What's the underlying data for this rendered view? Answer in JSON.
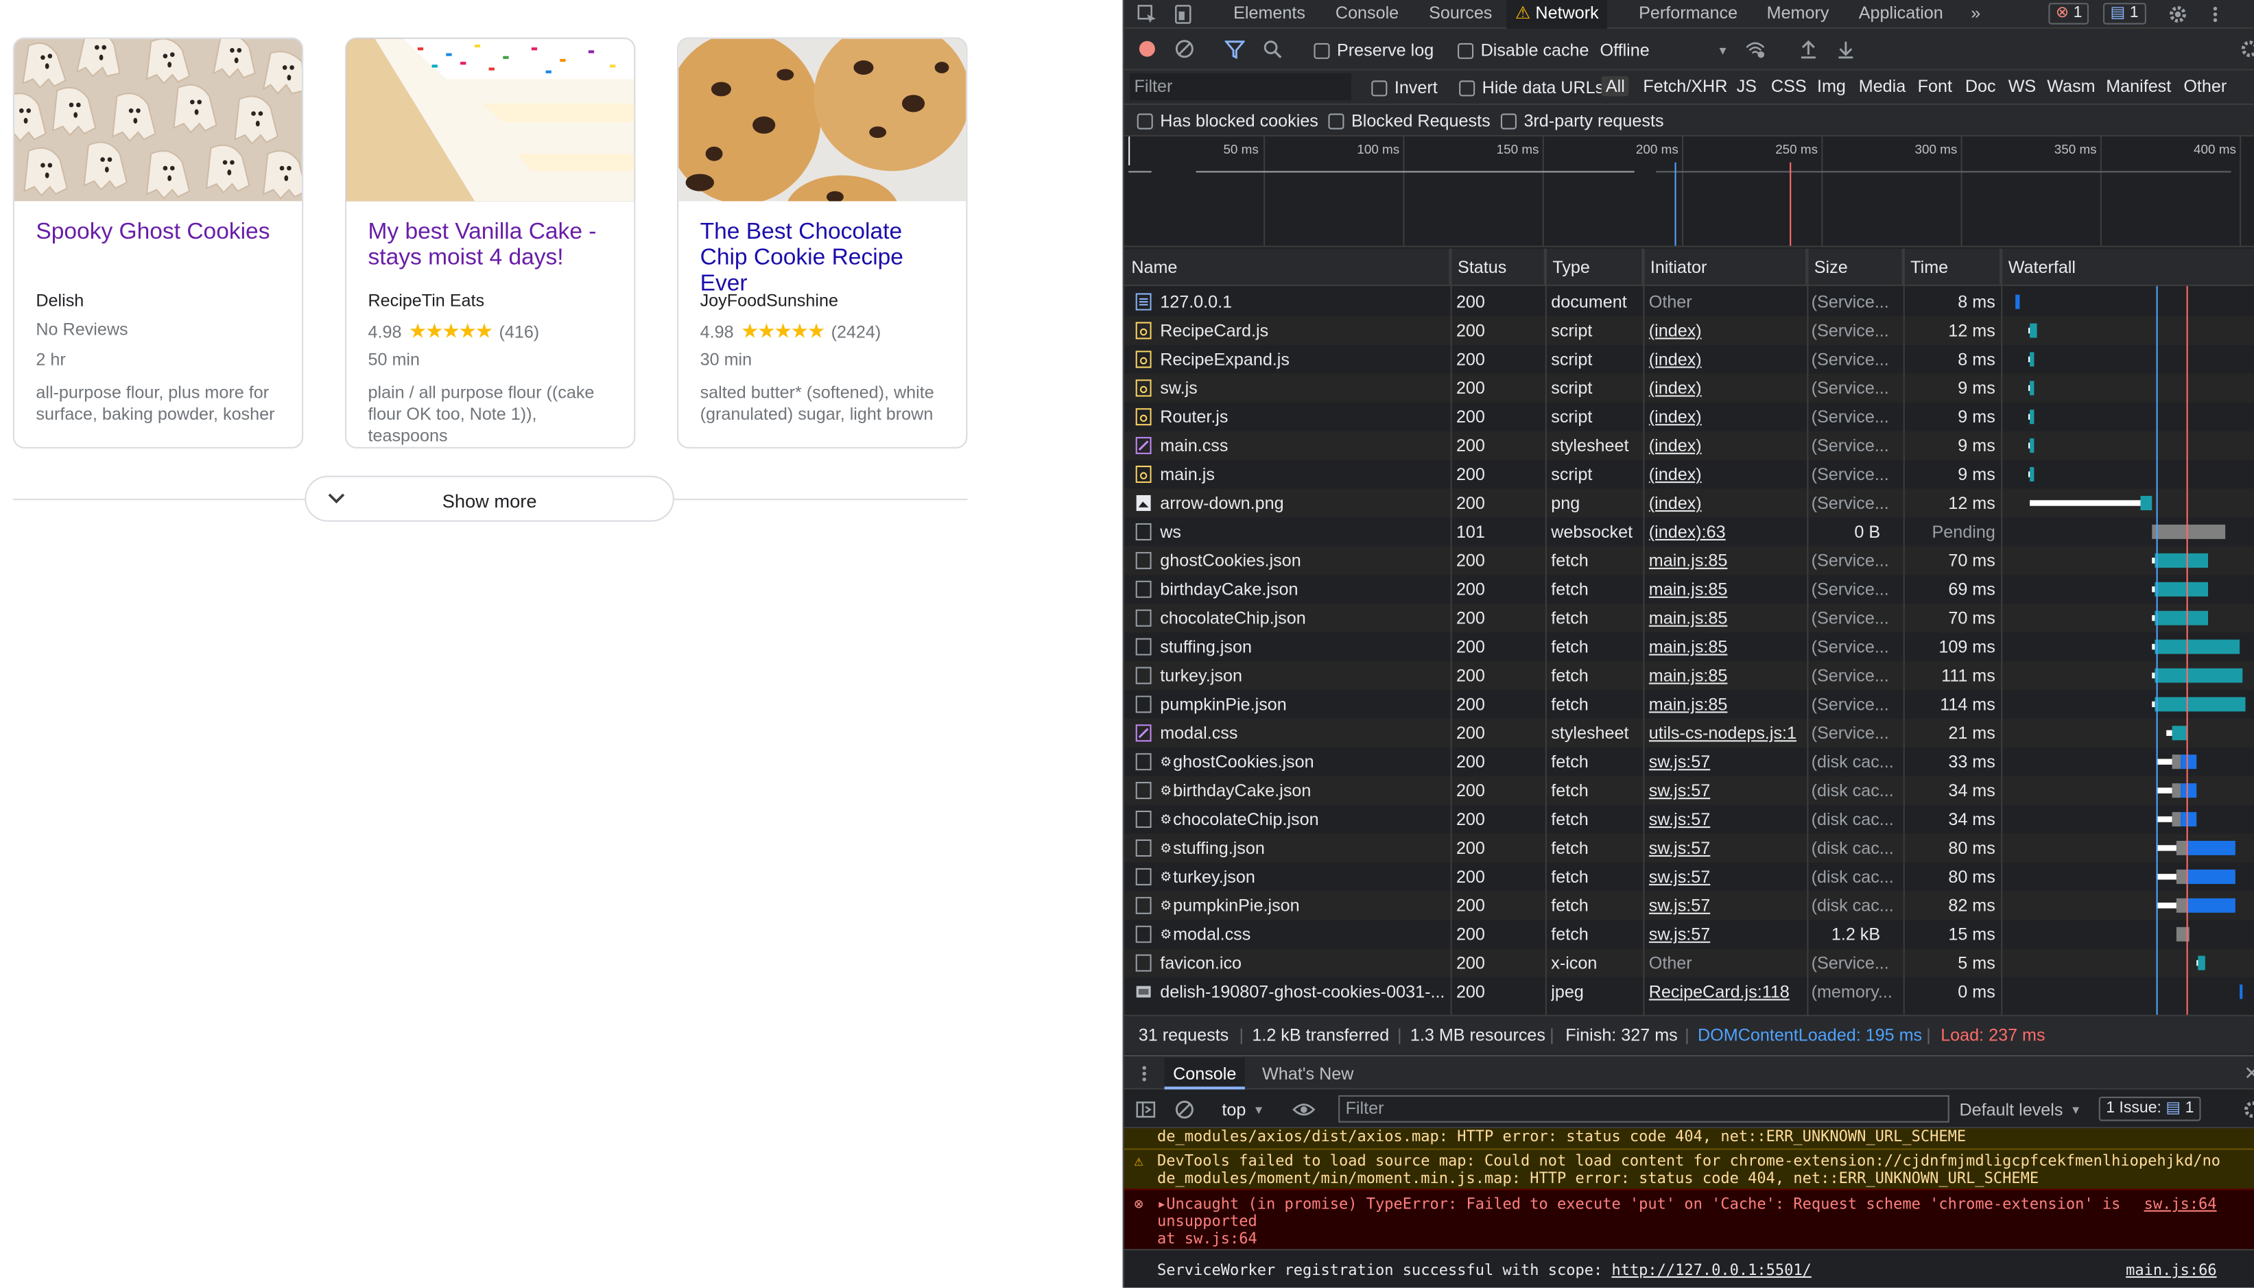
{
  "cards": [
    {
      "title": "Spooky Ghost Cookies",
      "source": "Delish",
      "rating": "",
      "stars": "",
      "reviews": "",
      "no_reviews": "No Reviews",
      "time": "2 hr",
      "ingredients": "all-purpose flour, plus more for surface, baking powder, kosher"
    },
    {
      "title": "My best Vanilla Cake - stays moist 4 days!",
      "source": "RecipeTin Eats",
      "rating": "4.98",
      "stars": "★★★★★",
      "reviews": "(416)",
      "no_reviews": "",
      "time": "50 min",
      "ingredients": "plain / all purpose flour ((cake flour OK too, Note 1)), teaspoons"
    },
    {
      "title": "The Best Chocolate Chip Cookie Recipe Ever",
      "source": "JoyFoodSunshine",
      "rating": "4.98",
      "stars": "★★★★★",
      "reviews": "(2424)",
      "no_reviews": "",
      "time": "30 min",
      "ingredients": "salted butter* (softened), white (granulated) sugar, light brown"
    }
  ],
  "show_more": "Show more",
  "devtools": {
    "tabs": [
      "Elements",
      "Console",
      "Sources",
      "Network",
      "Performance",
      "Memory",
      "Application"
    ],
    "active_tab": "Network",
    "more_tabs": "»",
    "error_count": "1",
    "issue_count": "1",
    "toolbar": {
      "preserve_log": "Preserve log",
      "disable_cache": "Disable cache",
      "throttle": "Offline"
    },
    "filter": {
      "placeholder": "Filter",
      "invert": "Invert",
      "hide_data_urls": "Hide data URLs",
      "types": [
        "All",
        "Fetch/XHR",
        "JS",
        "CSS",
        "Img",
        "Media",
        "Font",
        "Doc",
        "WS",
        "Wasm",
        "Manifest",
        "Other"
      ]
    },
    "blocked": {
      "has_blocked_cookies": "Has blocked cookies",
      "blocked_requests": "Blocked Requests",
      "third_party": "3rd-party requests"
    },
    "overview_ticks": [
      "50 ms",
      "100 ms",
      "150 ms",
      "200 ms",
      "250 ms",
      "300 ms",
      "350 ms",
      "400 ms"
    ],
    "columns": [
      "Name",
      "Status",
      "Type",
      "Initiator",
      "Size",
      "Time",
      "Waterfall"
    ],
    "rows": [
      {
        "icon": "doc",
        "name": "127.0.0.1",
        "status": "200",
        "type": "document",
        "initiator": "Other",
        "size": "(Service...",
        "time": "8 ms",
        "wf": [
          {
            "s": 0.04,
            "w": 0.02,
            "c": "#1a73e8"
          }
        ]
      },
      {
        "icon": "js",
        "name": "RecipeCard.js",
        "status": "200",
        "type": "script",
        "initiator": "(index)",
        "size": "(Service...",
        "time": "12 ms",
        "wf": [
          {
            "s": 0.095,
            "w": 0.005,
            "c": "#ffffff"
          },
          {
            "s": 0.1,
            "w": 0.03,
            "c": "#1a9ca8"
          }
        ]
      },
      {
        "icon": "js",
        "name": "RecipeExpand.js",
        "status": "200",
        "type": "script",
        "initiator": "(index)",
        "size": "(Service...",
        "time": "8 ms",
        "wf": [
          {
            "s": 0.095,
            "w": 0.005,
            "c": "#ffffff"
          },
          {
            "s": 0.1,
            "w": 0.02,
            "c": "#1a9ca8"
          }
        ]
      },
      {
        "icon": "js",
        "name": "sw.js",
        "status": "200",
        "type": "script",
        "initiator": "(index)",
        "size": "(Service...",
        "time": "9 ms",
        "wf": [
          {
            "s": 0.095,
            "w": 0.005,
            "c": "#ffffff"
          },
          {
            "s": 0.1,
            "w": 0.02,
            "c": "#1a9ca8"
          }
        ]
      },
      {
        "icon": "js",
        "name": "Router.js",
        "status": "200",
        "type": "script",
        "initiator": "(index)",
        "size": "(Service...",
        "time": "9 ms",
        "wf": [
          {
            "s": 0.095,
            "w": 0.005,
            "c": "#ffffff"
          },
          {
            "s": 0.1,
            "w": 0.02,
            "c": "#1a9ca8"
          }
        ]
      },
      {
        "icon": "css",
        "name": "main.css",
        "status": "200",
        "type": "stylesheet",
        "initiator": "(index)",
        "size": "(Service...",
        "time": "9 ms",
        "wf": [
          {
            "s": 0.095,
            "w": 0.005,
            "c": "#ffffff"
          },
          {
            "s": 0.1,
            "w": 0.02,
            "c": "#1a9ca8"
          }
        ]
      },
      {
        "icon": "js",
        "name": "main.js",
        "status": "200",
        "type": "script",
        "initiator": "(index)",
        "size": "(Service...",
        "time": "9 ms",
        "wf": [
          {
            "s": 0.095,
            "w": 0.005,
            "c": "#ffffff"
          },
          {
            "s": 0.1,
            "w": 0.02,
            "c": "#1a9ca8"
          }
        ]
      },
      {
        "icon": "img",
        "name": "arrow-down.png",
        "status": "200",
        "type": "png",
        "initiator": "(index)",
        "size": "(Service...",
        "time": "12 ms",
        "wf": [
          {
            "s": 0.1,
            "w": 0.45,
            "c": "#ffffff"
          },
          {
            "s": 0.55,
            "w": 0.05,
            "c": "#1a9ca8"
          }
        ]
      },
      {
        "icon": "other",
        "name": "ws",
        "status": "101",
        "type": "websocket",
        "initiator": "(index):63",
        "size": "0 B",
        "size_num": true,
        "time": "Pending",
        "pending": true,
        "wf": [
          {
            "s": 0.6,
            "w": 0.3,
            "c": "#808080"
          }
        ]
      },
      {
        "icon": "other",
        "name": "ghostCookies.json",
        "status": "200",
        "type": "fetch",
        "initiator": "main.js:85",
        "size": "(Service...",
        "time": "70 ms",
        "wf": [
          {
            "s": 0.6,
            "w": 0.01,
            "c": "#ffffff"
          },
          {
            "s": 0.61,
            "w": 0.22,
            "c": "#1a9ca8"
          }
        ]
      },
      {
        "icon": "other",
        "name": "birthdayCake.json",
        "status": "200",
        "type": "fetch",
        "initiator": "main.js:85",
        "size": "(Service...",
        "time": "69 ms",
        "wf": [
          {
            "s": 0.6,
            "w": 0.01,
            "c": "#ffffff"
          },
          {
            "s": 0.61,
            "w": 0.22,
            "c": "#1a9ca8"
          }
        ]
      },
      {
        "icon": "other",
        "name": "chocolateChip.json",
        "status": "200",
        "type": "fetch",
        "initiator": "main.js:85",
        "size": "(Service...",
        "time": "70 ms",
        "wf": [
          {
            "s": 0.6,
            "w": 0.01,
            "c": "#ffffff"
          },
          {
            "s": 0.61,
            "w": 0.22,
            "c": "#1a9ca8"
          }
        ]
      },
      {
        "icon": "other",
        "name": "stuffing.json",
        "status": "200",
        "type": "fetch",
        "initiator": "main.js:85",
        "size": "(Service...",
        "time": "109 ms",
        "wf": [
          {
            "s": 0.6,
            "w": 0.01,
            "c": "#ffffff"
          },
          {
            "s": 0.61,
            "w": 0.35,
            "c": "#1a9ca8"
          }
        ]
      },
      {
        "icon": "other",
        "name": "turkey.json",
        "status": "200",
        "type": "fetch",
        "initiator": "main.js:85",
        "size": "(Service...",
        "time": "111 ms",
        "wf": [
          {
            "s": 0.6,
            "w": 0.01,
            "c": "#ffffff"
          },
          {
            "s": 0.61,
            "w": 0.36,
            "c": "#1a9ca8"
          }
        ]
      },
      {
        "icon": "other",
        "name": "pumpkinPie.json",
        "status": "200",
        "type": "fetch",
        "initiator": "main.js:85",
        "size": "(Service...",
        "time": "114 ms",
        "wf": [
          {
            "s": 0.6,
            "w": 0.01,
            "c": "#ffffff"
          },
          {
            "s": 0.61,
            "w": 0.37,
            "c": "#1a9ca8"
          }
        ]
      },
      {
        "icon": "css",
        "name": "modal.css",
        "status": "200",
        "type": "stylesheet",
        "initiator": "utils-cs-nodeps.js:1",
        "size": "(Service...",
        "time": "21 ms",
        "wf": [
          {
            "s": 0.66,
            "w": 0.02,
            "c": "#ffffff"
          },
          {
            "s": 0.68,
            "w": 0.06,
            "c": "#1a9ca8"
          }
        ]
      },
      {
        "icon": "other",
        "gear": true,
        "name": "ghostCookies.json",
        "status": "200",
        "type": "fetch",
        "initiator": "sw.js:57",
        "size": "(disk cac...",
        "time": "33 ms",
        "wf": [
          {
            "s": 0.62,
            "w": 0.06,
            "c": "#ffffff"
          },
          {
            "s": 0.68,
            "w": 0.04,
            "c": "#808080"
          },
          {
            "s": 0.72,
            "w": 0.06,
            "c": "#1a73e8"
          }
        ]
      },
      {
        "icon": "other",
        "gear": true,
        "name": "birthdayCake.json",
        "status": "200",
        "type": "fetch",
        "initiator": "sw.js:57",
        "size": "(disk cac...",
        "time": "34 ms",
        "wf": [
          {
            "s": 0.62,
            "w": 0.06,
            "c": "#ffffff"
          },
          {
            "s": 0.68,
            "w": 0.04,
            "c": "#808080"
          },
          {
            "s": 0.72,
            "w": 0.06,
            "c": "#1a73e8"
          }
        ]
      },
      {
        "icon": "other",
        "gear": true,
        "name": "chocolateChip.json",
        "status": "200",
        "type": "fetch",
        "initiator": "sw.js:57",
        "size": "(disk cac...",
        "time": "34 ms",
        "wf": [
          {
            "s": 0.62,
            "w": 0.06,
            "c": "#ffffff"
          },
          {
            "s": 0.68,
            "w": 0.04,
            "c": "#808080"
          },
          {
            "s": 0.72,
            "w": 0.06,
            "c": "#1a73e8"
          }
        ]
      },
      {
        "icon": "other",
        "gear": true,
        "name": "stuffing.json",
        "status": "200",
        "type": "fetch",
        "initiator": "sw.js:57",
        "size": "(disk cac...",
        "time": "80 ms",
        "wf": [
          {
            "s": 0.62,
            "w": 0.08,
            "c": "#ffffff"
          },
          {
            "s": 0.7,
            "w": 0.04,
            "c": "#808080"
          },
          {
            "s": 0.74,
            "w": 0.2,
            "c": "#1a73e8"
          }
        ]
      },
      {
        "icon": "other",
        "gear": true,
        "name": "turkey.json",
        "status": "200",
        "type": "fetch",
        "initiator": "sw.js:57",
        "size": "(disk cac...",
        "time": "80 ms",
        "wf": [
          {
            "s": 0.62,
            "w": 0.08,
            "c": "#ffffff"
          },
          {
            "s": 0.7,
            "w": 0.04,
            "c": "#808080"
          },
          {
            "s": 0.74,
            "w": 0.2,
            "c": "#1a73e8"
          }
        ]
      },
      {
        "icon": "other",
        "gear": true,
        "name": "pumpkinPie.json",
        "status": "200",
        "type": "fetch",
        "initiator": "sw.js:57",
        "size": "(disk cac...",
        "time": "82 ms",
        "wf": [
          {
            "s": 0.62,
            "w": 0.08,
            "c": "#ffffff"
          },
          {
            "s": 0.7,
            "w": 0.04,
            "c": "#808080"
          },
          {
            "s": 0.74,
            "w": 0.2,
            "c": "#1a73e8"
          }
        ]
      },
      {
        "icon": "other",
        "gear": true,
        "name": "modal.css",
        "status": "200",
        "type": "fetch",
        "initiator": "sw.js:57",
        "size": "1.2 kB",
        "size_num": true,
        "time": "15 ms",
        "wf": [
          {
            "s": 0.7,
            "w": 0.05,
            "c": "#808080"
          }
        ]
      },
      {
        "icon": "other",
        "name": "favicon.ico",
        "status": "200",
        "type": "x-icon",
        "initiator": "Other",
        "size": "(Service...",
        "time": "5 ms",
        "wf": [
          {
            "s": 0.78,
            "w": 0.01,
            "c": "#ffffff"
          },
          {
            "s": 0.79,
            "w": 0.03,
            "c": "#1a9ca8"
          }
        ]
      },
      {
        "icon": "jpeg",
        "name": "delish-190807-ghost-cookies-0031-...",
        "status": "200",
        "type": "jpeg",
        "initiator": "RecipeCard.js:118",
        "size": "(memory...",
        "time": "0 ms",
        "wf": [
          {
            "s": 0.96,
            "w": 0.01,
            "c": "#1a73e8"
          }
        ]
      }
    ],
    "summary": {
      "requests": "31 requests",
      "transferred": "1.2 kB transferred",
      "resources": "1.3 MB resources",
      "finish": "Finish: 327 ms",
      "dcl": "DOMContentLoaded: 195 ms",
      "load": "Load: 237 ms"
    },
    "drawer": {
      "tabs": [
        "Console",
        "What's New"
      ],
      "context": "top",
      "filter_placeholder": "Filter",
      "levels": "Default levels",
      "issues_label": "1 Issue:",
      "issues_count": "1"
    },
    "console": [
      {
        "kind": "warn-tail",
        "text": "de_modules/axios/dist/axios.map: HTTP error: status code 404, net::ERR_UNKNOWN_URL_SCHEME"
      },
      {
        "kind": "warn",
        "line1": "DevTools failed to load source map: Could not load content for chrome-extension://cjdnfmjmdligcpfcekfmenlhiopehjkd/no",
        "line2": "de_modules/moment/min/moment.min.js.map: HTTP error: status code 404, net::ERR_UNKNOWN_URL_SCHEME"
      },
      {
        "kind": "error",
        "line1": "▸Uncaught (in promise) TypeError: Failed to execute 'put' on 'Cache': Request scheme 'chrome-extension' is",
        "line2": "unsupported",
        "line3": "    at sw.js:64",
        "source": "sw.js:64"
      },
      {
        "kind": "info",
        "text": "ServiceWorker registration successful with scope: ",
        "link": "http://127.0.0.1:5501/",
        "source": "main.js:66"
      }
    ]
  },
  "colors": {
    "link": "#1a0dab",
    "visited": "#681da8",
    "star": "#fbbc04",
    "dcl": "#4fa3ff",
    "load": "#ff6b6b"
  }
}
